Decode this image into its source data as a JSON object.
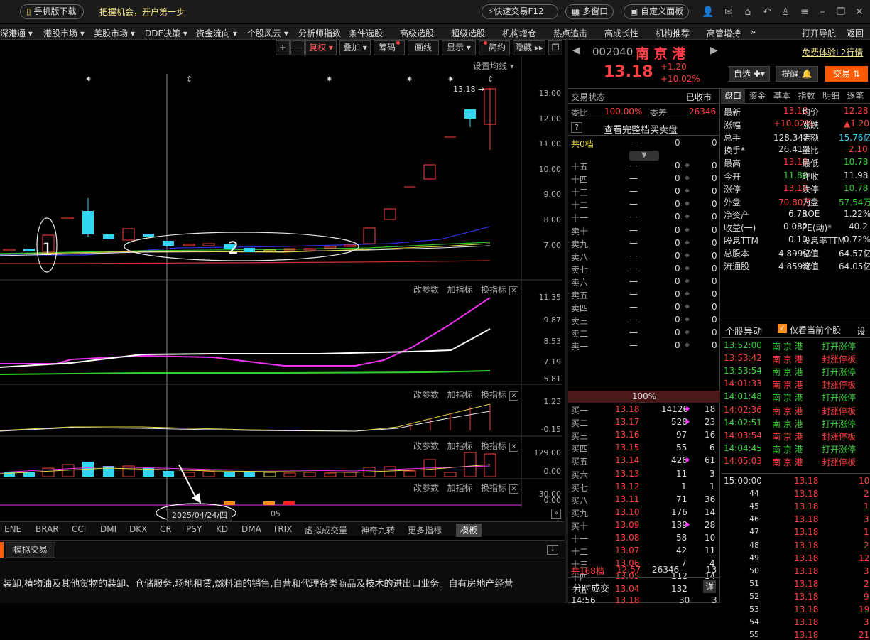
{
  "topbar": {
    "mobile_download": "手机版下载",
    "promo": "把握机会，开户第一步",
    "quick_trade": "快速交易F12",
    "multi_window": "多窗口",
    "custom_panel": "自定义面板"
  },
  "menu": {
    "items": [
      "深港通 ▾",
      "港股市场 ▾",
      "美股市场 ▾",
      "DDE决策 ▾",
      "资金流向 ▾",
      "个股风云 ▾",
      "分析师指数",
      "条件选股",
      "高级选股",
      "超级选股",
      "机构增仓",
      "热点追击",
      "高成长性",
      "机构推荐",
      "高管增持",
      "»",
      "打开导航",
      "返回"
    ]
  },
  "chart_toolbar": {
    "zoom_in": "+",
    "zoom_out": "—",
    "restore": "复权",
    "overlay": "叠加",
    "chips": "筹码",
    "draw": "画线",
    "display": "显示",
    "simple": "简约",
    "hide": "隐藏",
    "ma_settings": "设置均线"
  },
  "main_chart": {
    "price_axis": [
      "13.00",
      "12.00",
      "11.00",
      "10.00",
      "9.00",
      "8.00",
      "7.00"
    ],
    "last_price_label": "13.18",
    "annotations": [
      "1",
      "2"
    ],
    "date_label": "2025/04/24/四",
    "month_label": "05"
  },
  "panels": {
    "panel_tools": [
      "改参数",
      "加指标",
      "换指标"
    ],
    "p1_axis": [
      "11.35",
      "9.87",
      "8.53",
      "7.19",
      "5.81"
    ],
    "p2_axis": [
      "1.23",
      "-0.15"
    ],
    "p3_axis": [
      "129.00",
      "0.00"
    ],
    "p4_axis": [
      "30.00",
      "0.00"
    ]
  },
  "indicator_tabs": [
    "ENE",
    "BRAR",
    "CCI",
    "DMI",
    "DKX",
    "CR",
    "PSY",
    "KD",
    "DMA",
    "TRIX",
    "虚拟成交量",
    "神奇九转",
    "更多指标",
    "模板"
  ],
  "bottom": {
    "tab": "模拟交易",
    "text": "装卸,植物油及其他货物的装卸、仓储服务,场地租赁,燃料油的销售,自营和代理各类商品及技术的进出口业务。自有房地产经营"
  },
  "stock": {
    "code": "002040",
    "name": "南 京 港",
    "l2_link": "免费体验L2行情",
    "price": "13.18",
    "change": "+1.20",
    "change_pct": "+10.02%",
    "btn_watch": "自选",
    "btn_alert": "提醒",
    "btn_trade": "交易"
  },
  "orderbook": {
    "status_label": "交易状态",
    "status_value": "已收市",
    "weibi_label": "委比",
    "weibi_value": "100.00%",
    "weicha_label": "委差",
    "weicha_value": "26346",
    "full_book": "查看完整档买卖盘",
    "total_label": "共0档",
    "total_dash": "—",
    "total_a": "0",
    "total_b": "0",
    "sells": [
      [
        "十五",
        "—",
        "0",
        "0"
      ],
      [
        "十四",
        "—",
        "0",
        "0"
      ],
      [
        "十三",
        "—",
        "0",
        "0"
      ],
      [
        "十二",
        "—",
        "0",
        "0"
      ],
      [
        "十一",
        "—",
        "0",
        "0"
      ],
      [
        "卖十",
        "—",
        "0",
        "0"
      ],
      [
        "卖九",
        "—",
        "0",
        "0"
      ],
      [
        "卖八",
        "—",
        "0",
        "0"
      ],
      [
        "卖七",
        "—",
        "0",
        "0"
      ],
      [
        "卖六",
        "—",
        "0",
        "0"
      ],
      [
        "卖五",
        "—",
        "0",
        "0"
      ],
      [
        "卖四",
        "—",
        "0",
        "0"
      ],
      [
        "卖三",
        "—",
        "0",
        "0"
      ],
      [
        "卖二",
        "—",
        "0",
        "0"
      ],
      [
        "卖一",
        "—",
        "0",
        "0"
      ]
    ],
    "ratio": "100%",
    "buys": [
      [
        "买一",
        "13.18",
        "14126",
        "18"
      ],
      [
        "买二",
        "13.17",
        "528",
        "23"
      ],
      [
        "买三",
        "13.16",
        "97",
        "16"
      ],
      [
        "买四",
        "13.15",
        "55",
        "6"
      ],
      [
        "买五",
        "13.14",
        "426",
        "61"
      ],
      [
        "买六",
        "13.13",
        "11",
        "3"
      ],
      [
        "买七",
        "13.12",
        "1",
        "1"
      ],
      [
        "买八",
        "13.11",
        "71",
        "36"
      ],
      [
        "买九",
        "13.10",
        "176",
        "14"
      ],
      [
        "买十",
        "13.09",
        "139",
        "28"
      ],
      [
        "十一",
        "13.08",
        "58",
        "10"
      ],
      [
        "十二",
        "13.07",
        "42",
        "11"
      ],
      [
        "十三",
        "13.06",
        "7",
        "4"
      ],
      [
        "十四",
        "13.05",
        "112",
        "14"
      ],
      [
        "十五",
        "13.04",
        "132",
        "44"
      ]
    ],
    "footer_label": "共168档",
    "footer_price": "12.57",
    "footer_qty": "26346",
    "footer_cnt": "13",
    "trades_label": "分时成交",
    "trades_detail": "详",
    "last_row": [
      "14:56",
      "13.18",
      "30",
      "3"
    ]
  },
  "tabs_right": [
    "盘口",
    "资金",
    "基本",
    "指数",
    "明细",
    "逐笔"
  ],
  "quote": [
    [
      "最新",
      "13.18",
      "均价",
      "12.28"
    ],
    [
      "涨幅",
      "+10.02%",
      "涨跌",
      "▲1.20"
    ],
    [
      "总手",
      "128.34万",
      "金额",
      "15.76亿"
    ],
    [
      "换手*",
      "26.41%",
      "量比",
      "2.10"
    ],
    [
      "最高",
      "13.18",
      "最低",
      "10.78"
    ],
    [
      "今开",
      "11.80",
      "昨收",
      "11.98"
    ],
    [
      "涨停",
      "13.18",
      "跌停",
      "10.78"
    ],
    [
      "外盘",
      "70.80万",
      "内盘",
      "57.54万"
    ],
    [
      "净资产",
      "6.78",
      "ROE",
      "1.22%"
    ],
    [
      "收益(一)",
      "0.082",
      "PE(动)*",
      "40.2"
    ],
    [
      "股息TTM",
      "0.10",
      "股息率TTM",
      "0.72%"
    ],
    [
      "总股本",
      "4.899亿",
      "总值",
      "64.57亿"
    ],
    [
      "流通股",
      "4.859亿",
      "流值",
      "64.05亿"
    ]
  ],
  "alerts": {
    "title": "个股异动",
    "only_current": "仅看当前个股",
    "settings": "设",
    "rows": [
      [
        "13:52:00",
        "南 京 港",
        "打开涨停"
      ],
      [
        "13:53:42",
        "南 京 港",
        "封涨停板"
      ],
      [
        "13:53:54",
        "南 京 港",
        "打开涨停"
      ],
      [
        "14:01:33",
        "南 京 港",
        "封涨停板"
      ],
      [
        "14:01:48",
        "南 京 港",
        "打开涨停"
      ],
      [
        "14:02:36",
        "南 京 港",
        "封涨停板"
      ],
      [
        "14:02:51",
        "南 京 港",
        "打开涨停"
      ],
      [
        "14:03:54",
        "南 京 港",
        "封涨停板"
      ],
      [
        "14:04:45",
        "南 京 港",
        "打开涨停"
      ],
      [
        "14:05:03",
        "南 京 港",
        "封涨停板"
      ]
    ]
  },
  "ticks": [
    [
      "15:00:00",
      "13.18",
      "10"
    ],
    [
      "44",
      "13.18",
      "2"
    ],
    [
      "45",
      "13.18",
      "1"
    ],
    [
      "46",
      "13.18",
      "3"
    ],
    [
      "47",
      "13.18",
      "1"
    ],
    [
      "48",
      "13.18",
      "2"
    ],
    [
      "49",
      "13.18",
      "12"
    ],
    [
      "50",
      "13.18",
      "3"
    ],
    [
      "51",
      "13.18",
      "2"
    ],
    [
      "52",
      "13.18",
      "9"
    ],
    [
      "53",
      "13.18",
      "19"
    ],
    [
      "54",
      "13.18",
      "3"
    ],
    [
      "55",
      "13.18",
      "21"
    ]
  ],
  "colors": {
    "up": "#ff4040",
    "down": "#3cd33c",
    "flat": "#e8e8e8",
    "accent": "#ff5a00"
  }
}
